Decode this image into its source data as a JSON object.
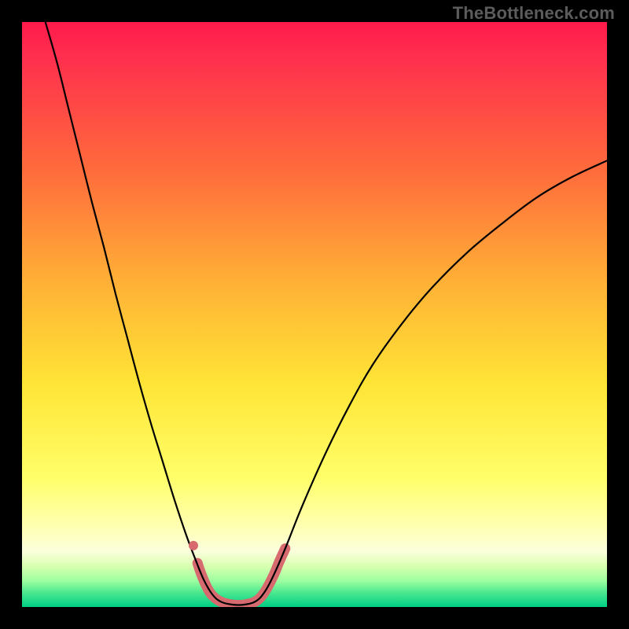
{
  "watermark": "TheBottleneck.com",
  "chart_data": {
    "type": "line",
    "title": "",
    "xlabel": "",
    "ylabel": "",
    "xlim": [
      0,
      100
    ],
    "ylim": [
      0,
      100
    ],
    "background_gradient": {
      "stops": [
        {
          "offset": 0.0,
          "color": "#ff1a4b"
        },
        {
          "offset": 0.06,
          "color": "#ff2f4e"
        },
        {
          "offset": 0.25,
          "color": "#ff6a3c"
        },
        {
          "offset": 0.45,
          "color": "#ffb236"
        },
        {
          "offset": 0.62,
          "color": "#ffe536"
        },
        {
          "offset": 0.78,
          "color": "#ffff6a"
        },
        {
          "offset": 0.86,
          "color": "#ffffb0"
        },
        {
          "offset": 0.905,
          "color": "#fbffdc"
        },
        {
          "offset": 0.93,
          "color": "#d8ffb0"
        },
        {
          "offset": 0.955,
          "color": "#9effa0"
        },
        {
          "offset": 0.975,
          "color": "#4de88f"
        },
        {
          "offset": 1.0,
          "color": "#00d084"
        }
      ]
    },
    "series": [
      {
        "name": "bottleneck-curve",
        "stroke": "#000000",
        "stroke_width": 2.2,
        "points": [
          {
            "x": 4.0,
            "y": 100.0
          },
          {
            "x": 6.0,
            "y": 93.0
          },
          {
            "x": 8.0,
            "y": 85.0
          },
          {
            "x": 10.0,
            "y": 77.0
          },
          {
            "x": 12.0,
            "y": 69.0
          },
          {
            "x": 14.0,
            "y": 61.5
          },
          {
            "x": 16.0,
            "y": 53.5
          },
          {
            "x": 18.0,
            "y": 46.0
          },
          {
            "x": 20.0,
            "y": 38.5
          },
          {
            "x": 22.0,
            "y": 31.5
          },
          {
            "x": 24.0,
            "y": 25.0
          },
          {
            "x": 26.0,
            "y": 18.5
          },
          {
            "x": 28.0,
            "y": 12.5
          },
          {
            "x": 29.5,
            "y": 8.5
          },
          {
            "x": 31.0,
            "y": 4.8
          },
          {
            "x": 32.5,
            "y": 2.2
          },
          {
            "x": 34.0,
            "y": 0.9
          },
          {
            "x": 36.0,
            "y": 0.4
          },
          {
            "x": 38.0,
            "y": 0.4
          },
          {
            "x": 40.0,
            "y": 1.0
          },
          {
            "x": 41.5,
            "y": 2.6
          },
          {
            "x": 43.0,
            "y": 5.4
          },
          {
            "x": 45.0,
            "y": 10.0
          },
          {
            "x": 48.0,
            "y": 17.5
          },
          {
            "x": 52.0,
            "y": 26.5
          },
          {
            "x": 56.0,
            "y": 34.5
          },
          {
            "x": 60.0,
            "y": 41.5
          },
          {
            "x": 65.0,
            "y": 48.5
          },
          {
            "x": 70.0,
            "y": 54.5
          },
          {
            "x": 76.0,
            "y": 60.5
          },
          {
            "x": 82.0,
            "y": 65.5
          },
          {
            "x": 88.0,
            "y": 70.0
          },
          {
            "x": 94.0,
            "y": 73.5
          },
          {
            "x": 100.0,
            "y": 76.3
          }
        ]
      },
      {
        "name": "highlight-band",
        "stroke": "#d76a6f",
        "stroke_width": 13,
        "points": [
          {
            "x": 30.0,
            "y": 7.5
          },
          {
            "x": 30.5,
            "y": 6.0
          },
          {
            "x": 31.5,
            "y": 3.6
          },
          {
            "x": 32.5,
            "y": 2.0
          },
          {
            "x": 34.0,
            "y": 0.9
          },
          {
            "x": 36.0,
            "y": 0.4
          },
          {
            "x": 38.0,
            "y": 0.4
          },
          {
            "x": 40.0,
            "y": 1.0
          },
          {
            "x": 41.5,
            "y": 2.6
          },
          {
            "x": 43.0,
            "y": 5.4
          },
          {
            "x": 44.0,
            "y": 7.8
          },
          {
            "x": 45.0,
            "y": 10.0
          }
        ]
      },
      {
        "name": "highlight-dot",
        "type": "scatter",
        "fill": "#d76a6f",
        "radius": 6,
        "points": [
          {
            "x": 29.3,
            "y": 10.5
          }
        ]
      }
    ]
  }
}
